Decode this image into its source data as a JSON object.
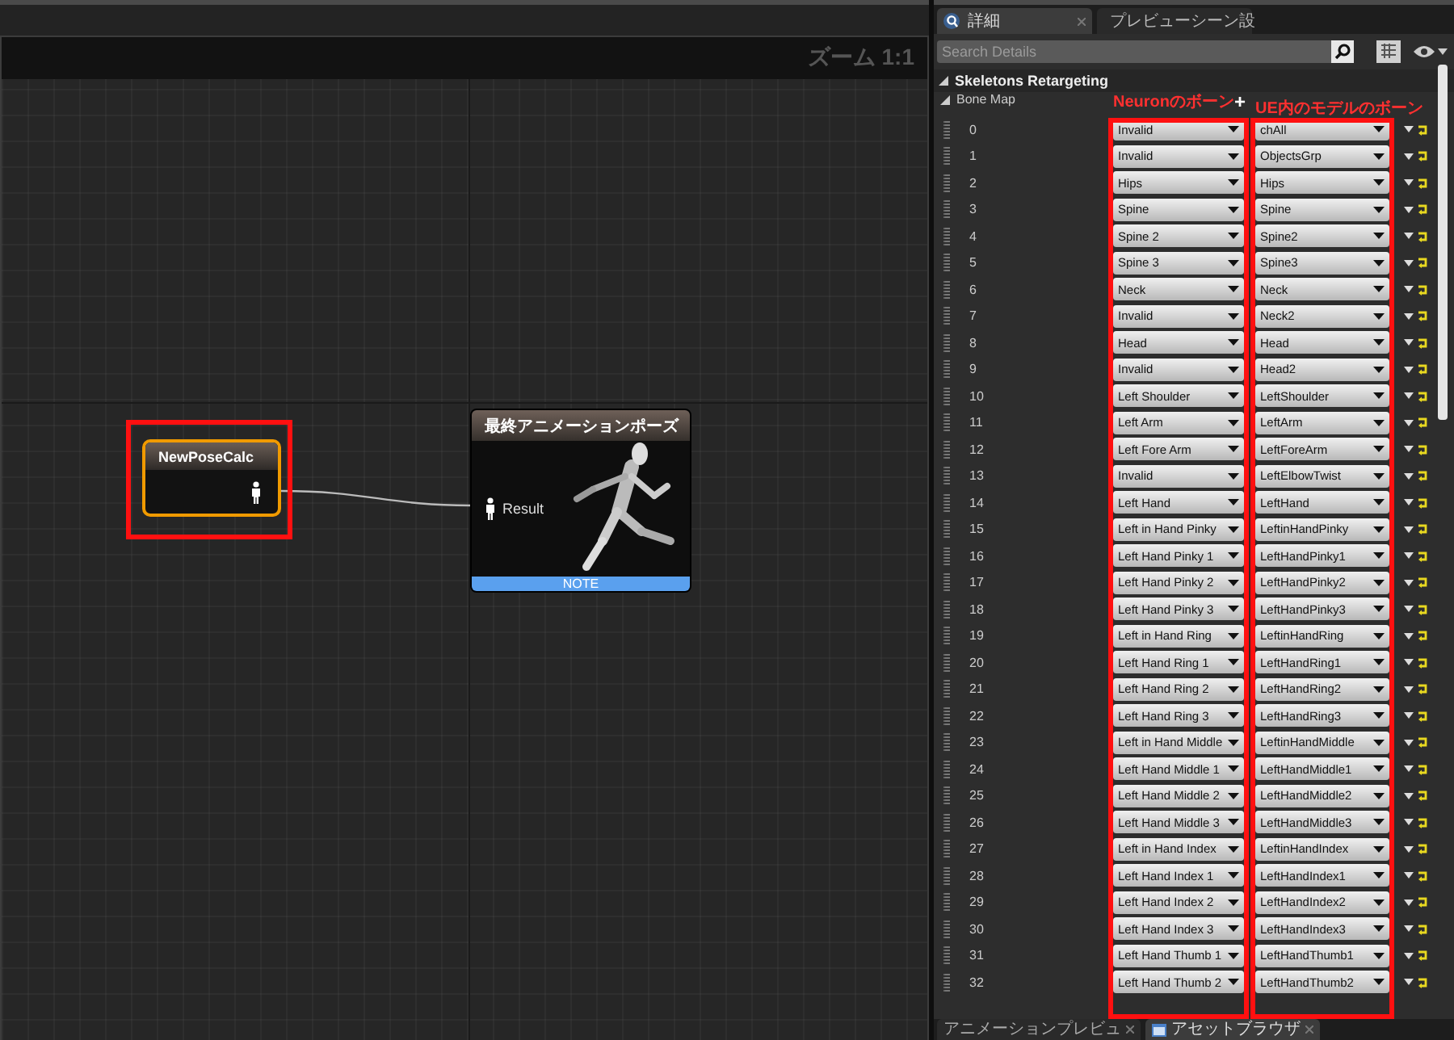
{
  "graph": {
    "zoom_label": "ズーム 1:1",
    "nodes": [
      {
        "kind": "source",
        "title": "NewPoseCalc",
        "selected": true
      },
      {
        "kind": "result",
        "title": "最終アニメーションポーズ",
        "pin_label": "Result",
        "footer": "NOTE",
        "selected": false
      }
    ]
  },
  "details": {
    "tabs": [
      {
        "label": "詳細",
        "selected": true
      },
      {
        "label": "プレビューシーン設",
        "selected": false
      }
    ],
    "search": {
      "placeholder": "Search Details"
    },
    "section": {
      "title": "Skeletons Retargeting",
      "expanded": true
    },
    "bone_map": {
      "label": "Bone Map",
      "expanded": true,
      "source_note": "Neuronのボーン",
      "add_button": "+",
      "target_note": "UE内のモデルのボーン",
      "rows": [
        {
          "index": "0",
          "source": "Invalid",
          "target": "chAll"
        },
        {
          "index": "1",
          "source": "Invalid",
          "target": "ObjectsGrp"
        },
        {
          "index": "2",
          "source": "Hips",
          "target": "Hips"
        },
        {
          "index": "3",
          "source": "Spine",
          "target": "Spine"
        },
        {
          "index": "4",
          "source": "Spine 2",
          "target": "Spine2"
        },
        {
          "index": "5",
          "source": "Spine 3",
          "target": "Spine3"
        },
        {
          "index": "6",
          "source": "Neck",
          "target": "Neck"
        },
        {
          "index": "7",
          "source": "Invalid",
          "target": "Neck2"
        },
        {
          "index": "8",
          "source": "Head",
          "target": "Head"
        },
        {
          "index": "9",
          "source": "Invalid",
          "target": "Head2"
        },
        {
          "index": "10",
          "source": "Left Shoulder",
          "target": "LeftShoulder"
        },
        {
          "index": "11",
          "source": "Left Arm",
          "target": "LeftArm"
        },
        {
          "index": "12",
          "source": "Left Fore Arm",
          "target": "LeftForeArm"
        },
        {
          "index": "13",
          "source": "Invalid",
          "target": "LeftElbowTwist"
        },
        {
          "index": "14",
          "source": "Left Hand",
          "target": "LeftHand"
        },
        {
          "index": "15",
          "source": "Left in Hand Pinky",
          "target": "LeftinHandPinky"
        },
        {
          "index": "16",
          "source": "Left Hand Pinky 1",
          "target": "LeftHandPinky1"
        },
        {
          "index": "17",
          "source": "Left Hand Pinky 2",
          "target": "LeftHandPinky2"
        },
        {
          "index": "18",
          "source": "Left Hand Pinky 3",
          "target": "LeftHandPinky3"
        },
        {
          "index": "19",
          "source": "Left in Hand Ring",
          "target": "LeftinHandRing"
        },
        {
          "index": "20",
          "source": "Left Hand Ring 1",
          "target": "LeftHandRing1"
        },
        {
          "index": "21",
          "source": "Left Hand Ring 2",
          "target": "LeftHandRing2"
        },
        {
          "index": "22",
          "source": "Left Hand Ring 3",
          "target": "LeftHandRing3"
        },
        {
          "index": "23",
          "source": "Left in Hand Middle",
          "target": "LeftinHandMiddle"
        },
        {
          "index": "24",
          "source": "Left Hand Middle 1",
          "target": "LeftHandMiddle1"
        },
        {
          "index": "25",
          "source": "Left Hand Middle 2",
          "target": "LeftHandMiddle2"
        },
        {
          "index": "26",
          "source": "Left Hand Middle 3",
          "target": "LeftHandMiddle3"
        },
        {
          "index": "27",
          "source": "Left in Hand Index",
          "target": "LeftinHandIndex"
        },
        {
          "index": "28",
          "source": "Left Hand Index 1",
          "target": "LeftHandIndex1"
        },
        {
          "index": "29",
          "source": "Left Hand Index 2",
          "target": "LeftHandIndex2"
        },
        {
          "index": "30",
          "source": "Left Hand Index 3",
          "target": "LeftHandIndex3"
        },
        {
          "index": "31",
          "source": "Left Hand Thumb 1",
          "target": "LeftHandThumb1"
        },
        {
          "index": "32",
          "source": "Left Hand Thumb 2",
          "target": "LeftHandThumb2"
        }
      ]
    }
  },
  "bottom_tabs": [
    {
      "label": "アニメーションプレビュ",
      "selected": false
    },
    {
      "label": "アセットブラウザ",
      "selected": true
    }
  ]
}
